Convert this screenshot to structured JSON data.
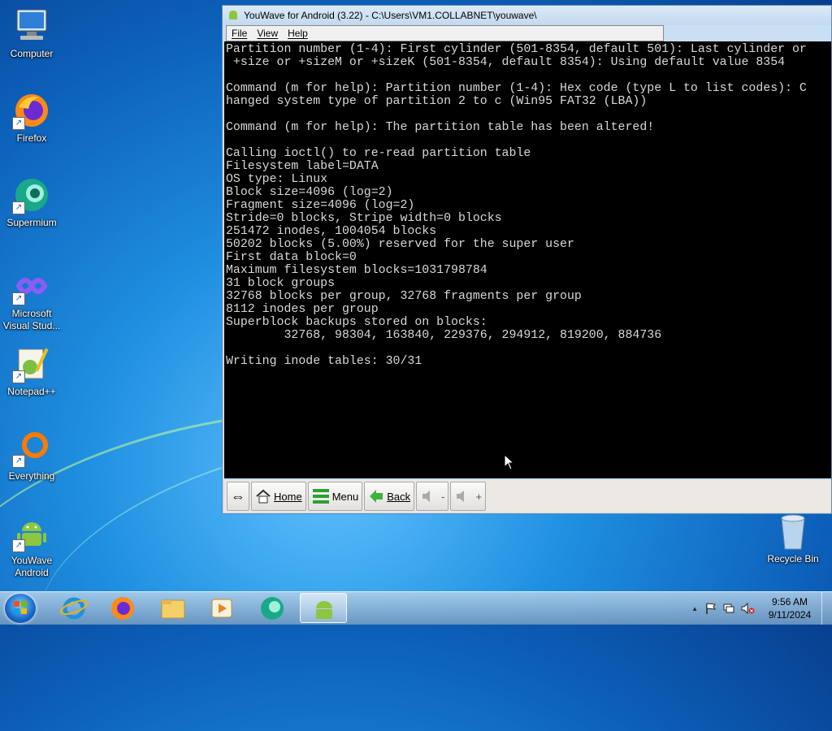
{
  "desktop": {
    "icons": [
      {
        "label": "Computer"
      },
      {
        "label": "Firefox"
      },
      {
        "label": "Supermium"
      },
      {
        "label_line1": "Microsoft",
        "label_line2": "Visual Stud..."
      },
      {
        "label": "Notepad++"
      },
      {
        "label": "Everything"
      },
      {
        "label_line1": "YouWave",
        "label_line2": "Android"
      }
    ],
    "recycle_bin": {
      "label": "Recycle Bin"
    }
  },
  "window": {
    "title": "YouWave for Android (3.22) - C:\\Users\\VM1.COLLABNET\\youwave\\",
    "menu": [
      "File",
      "View",
      "Help"
    ],
    "terminal_lines": [
      "Partition number (1-4): First cylinder (501-8354, default 501): Last cylinder or",
      " +size or +sizeM or +sizeK (501-8354, default 8354): Using default value 8354",
      "",
      "Command (m for help): Partition number (1-4): Hex code (type L to list codes): C",
      "hanged system type of partition 2 to c (Win95 FAT32 (LBA))",
      "",
      "Command (m for help): The partition table has been altered!",
      "",
      "Calling ioctl() to re-read partition table",
      "Filesystem label=DATA",
      "OS type: Linux",
      "Block size=4096 (log=2)",
      "Fragment size=4096 (log=2)",
      "Stride=0 blocks, Stripe width=0 blocks",
      "251472 inodes, 1004054 blocks",
      "50202 blocks (5.00%) reserved for the super user",
      "First data block=0",
      "Maximum filesystem blocks=1031798784",
      "31 block groups",
      "32768 blocks per group, 32768 fragments per group",
      "8112 inodes per group",
      "Superblock backups stored on blocks:",
      "        32768, 98304, 163840, 229376, 294912, 819200, 884736",
      "",
      "Writing inode tables: 30/31"
    ],
    "toolbar": {
      "rotate_symbol": "⇔",
      "home": "Home",
      "menu": "Menu",
      "back": "Back",
      "vol_down": "-",
      "vol_up": "+"
    }
  },
  "taskbar": {
    "clock_time": "9:56 AM",
    "clock_date": "9/11/2024",
    "tray_arrow": "▲"
  },
  "colors": {
    "terminal_bg": "#000000",
    "terminal_fg": "#d8d8d8",
    "window_frame": "#c9dff3"
  }
}
